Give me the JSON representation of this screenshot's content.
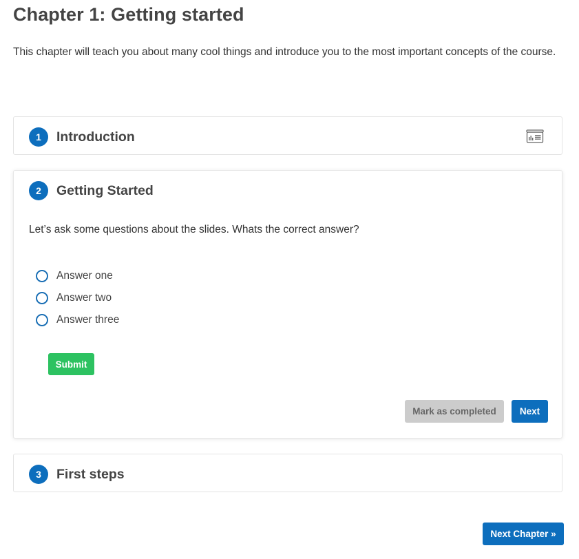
{
  "chapter": {
    "title": "Chapter 1: Getting started",
    "description": "This chapter will teach you about many cool things and introduce you to the most important concepts of the course."
  },
  "steps": [
    {
      "number": "1",
      "title": "Introduction",
      "icon": "slides-icon"
    },
    {
      "number": "2",
      "title": "Getting Started",
      "question": "Let’s ask some questions about the slides. Whats the correct answer?",
      "answers": [
        {
          "label": "Answer one",
          "checked": false
        },
        {
          "label": "Answer two",
          "checked": false
        },
        {
          "label": "Answer three",
          "checked": false
        }
      ],
      "submit_label": "Submit",
      "mark_completed_label": "Mark as completed",
      "next_label": "Next"
    },
    {
      "number": "3",
      "title": "First steps"
    }
  ],
  "footer": {
    "next_chapter_label": "Next Chapter »"
  },
  "colors": {
    "primary": "#0d6ebd",
    "submit": "#2dc261",
    "disabled": "#cccccc"
  }
}
